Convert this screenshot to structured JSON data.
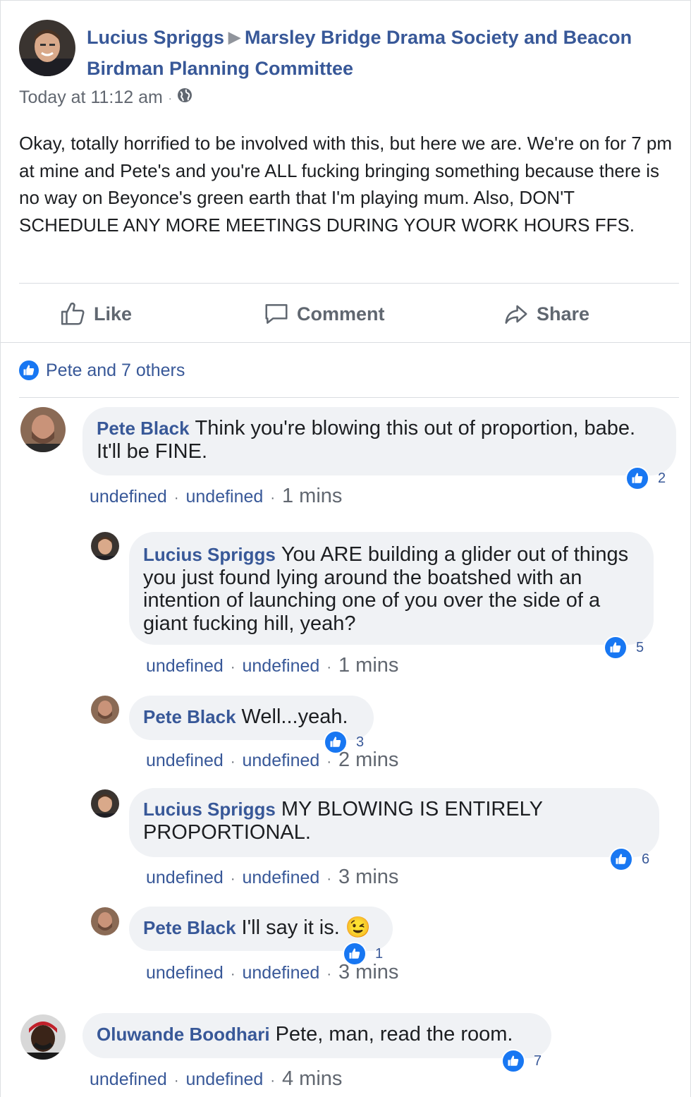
{
  "post": {
    "author": "Lucius Spriggs",
    "target": "Marsley Bridge Drama Society and Beacon Birdman Planning Committee",
    "timestamp": "Today at 11:12 am",
    "text": "Okay, totally horrified to be involved with this, but here we are. We're on for 7 pm at mine and Pete's and you're ALL fucking bringing something because there is no way on Beyonce's green earth that I'm playing mum. Also, DON'T SCHEDULE ANY MORE MEETINGS DURING YOUR WORK HOURS FFS.",
    "actions": {
      "like": "Like",
      "comment": "Comment",
      "share": "Share"
    },
    "likes_summary": "Pete and 7 others"
  },
  "comments": [
    {
      "author": "Pete Black",
      "text": "Think you're blowing this out of proportion, babe. It'll be FINE.",
      "likes": "2",
      "link1": "undefined",
      "link2": "undefined",
      "time": "1 mins"
    },
    {
      "author": "Lucius Spriggs",
      "text": "You ARE building a glider out of things you just found lying around the boatshed with an intention of launching one of you over the side of a giant fucking hill, yeah?",
      "likes": "5",
      "link1": "undefined",
      "link2": "undefined",
      "time": "1 mins"
    },
    {
      "author": "Pete Black",
      "text": "Well...yeah.",
      "likes": "3",
      "link1": "undefined",
      "link2": "undefined",
      "time": "2 mins"
    },
    {
      "author": "Lucius Spriggs",
      "text": "MY BLOWING IS ENTIRELY PROPORTIONAL.",
      "likes": "6",
      "link1": "undefined",
      "link2": "undefined",
      "time": "3 mins"
    },
    {
      "author": "Pete Black",
      "text": "I'll say it is. 😉",
      "likes": "1",
      "link1": "undefined",
      "link2": "undefined",
      "time": "3 mins"
    },
    {
      "author": "Oluwande Boodhari",
      "text": "Pete, man, read the room.",
      "likes": "7",
      "link1": "undefined",
      "link2": "undefined",
      "time": "4 mins"
    }
  ],
  "colors": {
    "link": "#385898",
    "like_blue": "#1877f2",
    "bubble": "#f0f2f5"
  }
}
